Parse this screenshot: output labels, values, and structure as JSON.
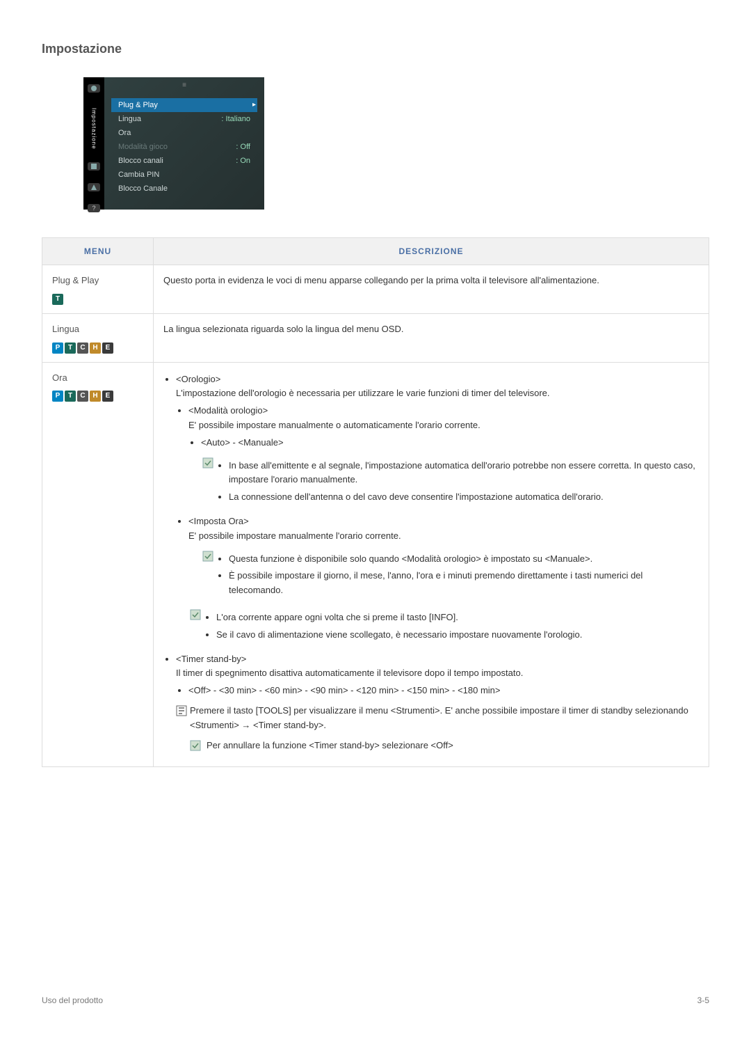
{
  "heading": "Impostazione",
  "tv_menu": {
    "side_label": "Impostazione",
    "rows": [
      {
        "label": "Plug & Play",
        "value": "",
        "cls": "sel"
      },
      {
        "label": "Lingua",
        "value": ": Italiano",
        "cls": ""
      },
      {
        "label": "Ora",
        "value": "",
        "cls": ""
      },
      {
        "label": "Modalità gioco",
        "value": ": Off",
        "cls": "dim"
      },
      {
        "label": "Blocco canali",
        "value": ": On",
        "cls": ""
      },
      {
        "label": "Cambia PIN",
        "value": "",
        "cls": ""
      },
      {
        "label": "Blocco Canale",
        "value": "",
        "cls": ""
      }
    ]
  },
  "table": {
    "head_menu": "MENU",
    "head_desc": "DESCRIZIONE",
    "row1": {
      "name": "Plug & Play",
      "tags": [
        "T"
      ],
      "desc": "Questo porta in evidenza le voci di menu apparse collegando per la prima volta il televisore all'alimentazione."
    },
    "row2": {
      "name": "Lingua",
      "tags": [
        "P",
        "T",
        "C",
        "H",
        "E"
      ],
      "desc": "La lingua selezionata riguarda solo la lingua del menu OSD."
    },
    "row3": {
      "name": "Ora",
      "tags": [
        "P",
        "T",
        "C",
        "H",
        "E"
      ],
      "orologio_title": "<Orologio>",
      "orologio_intro": "L'impostazione dell'orologio è necessaria per utilizzare le varie funzioni di timer del televisore.",
      "modalita_title": "<Modalità orologio>",
      "modalita_intro": "E' possibile impostare manualmente o automaticamente l'orario corrente.",
      "modalita_opts": "<Auto> - <Manuale>",
      "note1_a": "In base all'emittente e al segnale, l'impostazione automatica dell'orario potrebbe non essere corretta. In questo caso, impostare l'orario manualmente.",
      "note1_b": "La connessione dell'antenna o del cavo deve consentire l'impostazione automatica dell'orario.",
      "imposta_title": "<Imposta Ora>",
      "imposta_intro": "E' possibile impostare manualmente l'orario corrente.",
      "note2_a": "Questa funzione è disponibile solo quando <Modalità orologio> è impostato su <Manuale>.",
      "note2_b": "È possibile impostare il giorno, il mese, l'anno, l'ora e i minuti premendo direttamente i tasti numerici del telecomando.",
      "note3_a": "L'ora corrente appare ogni volta che si preme il tasto [INFO].",
      "note3_b": "Se il cavo di alimentazione viene scollegato, è necessario impostare nuovamente l'orologio.",
      "timer_title": "<Timer stand-by>",
      "timer_intro": "Il timer di spegnimento disattiva automaticamente il televisore dopo il tempo impostato.",
      "timer_opts": "<Off> - <30 min> - <60 min> - <90 min> - <120 min> - <150 min> - <180 min>",
      "tools_line": "Premere il tasto [TOOLS] per visualizzare il menu <Strumenti>. E' anche possibile impostare il timer di standby selezionando <Strumenti> → <Timer stand-by>.",
      "note4": "Per annullare la funzione <Timer stand-by> selezionare <Off>"
    }
  },
  "footer": {
    "left": "Uso del prodotto",
    "right": "3-5"
  }
}
